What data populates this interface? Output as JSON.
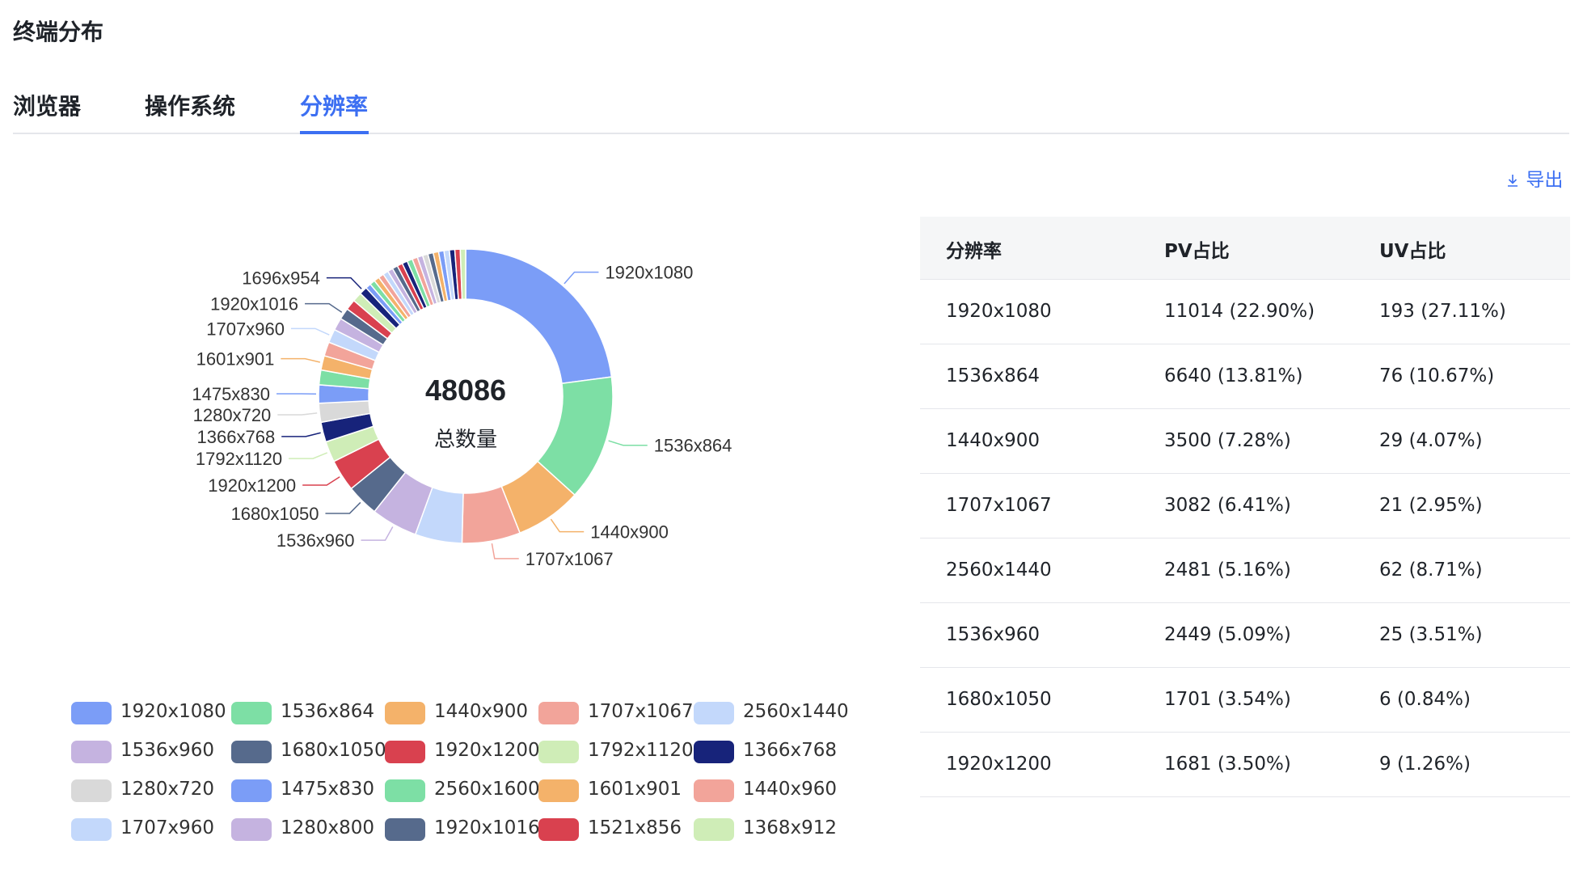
{
  "page": {
    "title": "终端分布"
  },
  "tabs": [
    {
      "label": "浏览器",
      "active": false
    },
    {
      "label": "操作系统",
      "active": false
    },
    {
      "label": "分辨率",
      "active": true
    }
  ],
  "toolbar": {
    "export_icon": "download-icon",
    "export_label": "导出"
  },
  "chart_data": {
    "type": "pie",
    "variant": "donut",
    "center_value": "48086",
    "center_label": "总数量",
    "total": 48086,
    "slices": [
      {
        "name": "1920x1080",
        "value": 11014,
        "color": "#7b9df7"
      },
      {
        "name": "1536x864",
        "value": 6640,
        "color": "#7ddfa5"
      },
      {
        "name": "1440x900",
        "value": 3500,
        "color": "#f4b26a"
      },
      {
        "name": "1707x1067",
        "value": 3082,
        "color": "#f2a49a"
      },
      {
        "name": "2560x1440",
        "value": 2481,
        "color": "#c3d8fb"
      },
      {
        "name": "1536x960",
        "value": 2449,
        "color": "#c5b3e0"
      },
      {
        "name": "1680x1050",
        "value": 1701,
        "color": "#566a8c"
      },
      {
        "name": "1920x1200",
        "value": 1681,
        "color": "#d9414f"
      },
      {
        "name": "1792x1120",
        "value": 1100,
        "color": "#cfedb7"
      },
      {
        "name": "1366x768",
        "value": 1050,
        "color": "#17237a"
      },
      {
        "name": "1280x720",
        "value": 1000,
        "color": "#d9d9d9"
      },
      {
        "name": "1475x830",
        "value": 960,
        "color": "#7b9df7"
      },
      {
        "name": "2560x1600",
        "value": 780,
        "color": "#7ddfa5"
      },
      {
        "name": "1601x901",
        "value": 760,
        "color": "#f4b26a"
      },
      {
        "name": "1440x960",
        "value": 740,
        "color": "#f2a49a"
      },
      {
        "name": "1707x960",
        "value": 720,
        "color": "#c3d8fb"
      },
      {
        "name": "1280x800",
        "value": 660,
        "color": "#c5b3e0"
      },
      {
        "name": "1920x1016",
        "value": 600,
        "color": "#566a8c"
      },
      {
        "name": "1521x856",
        "value": 560,
        "color": "#d9414f"
      },
      {
        "name": "1368x912",
        "value": 500,
        "color": "#cfedb7"
      },
      {
        "name": "1696x954",
        "value": 420,
        "color": "#17237a"
      }
    ],
    "tail_colors": [
      "#7b9df7",
      "#7ddfa5",
      "#f4b26a",
      "#f2a49a",
      "#c3d8fb",
      "#c5b3e0",
      "#566a8c",
      "#d9414f",
      "#17237a",
      "#7ddfa5",
      "#f2a49a",
      "#c5b3e0",
      "#d9d9d9",
      "#566a8c",
      "#f4b26a",
      "#7b9df7",
      "#c3d8fb",
      "#17237a",
      "#d9414f",
      "#cfedb7"
    ],
    "labeled_slices": [
      "1920x1080",
      "1536x864",
      "1440x900",
      "1707x1067",
      "1536x960",
      "1680x1050",
      "1920x1200",
      "1792x1120",
      "1366x768",
      "1280x720",
      "1475x830",
      "1601x901",
      "1707x960",
      "1920x1016",
      "1696x954"
    ],
    "legend_position": "bottom"
  },
  "legend": [
    "1920x1080",
    "1536x864",
    "1440x900",
    "1707x1067",
    "2560x1440",
    "1536x960",
    "1680x1050",
    "1920x1200",
    "1792x1120",
    "1366x768",
    "1280x720",
    "1475x830",
    "2560x1600",
    "1601x901",
    "1440x960",
    "1707x960",
    "1280x800",
    "1920x1016",
    "1521x856",
    "1368x912"
  ],
  "table": {
    "columns": [
      "分辨率",
      "PV占比",
      "UV占比"
    ],
    "rows": [
      [
        "1920x1080",
        "11014 (22.90%)",
        "193 (27.11%)"
      ],
      [
        "1536x864",
        "6640 (13.81%)",
        "76 (10.67%)"
      ],
      [
        "1440x900",
        "3500 (7.28%)",
        "29 (4.07%)"
      ],
      [
        "1707x1067",
        "3082 (6.41%)",
        "21 (2.95%)"
      ],
      [
        "2560x1440",
        "2481 (5.16%)",
        "62 (8.71%)"
      ],
      [
        "1536x960",
        "2449 (5.09%)",
        "25 (3.51%)"
      ],
      [
        "1680x1050",
        "1701 (3.54%)",
        "6 (0.84%)"
      ],
      [
        "1920x1200",
        "1681 (3.50%)",
        "9 (1.26%)"
      ]
    ]
  }
}
